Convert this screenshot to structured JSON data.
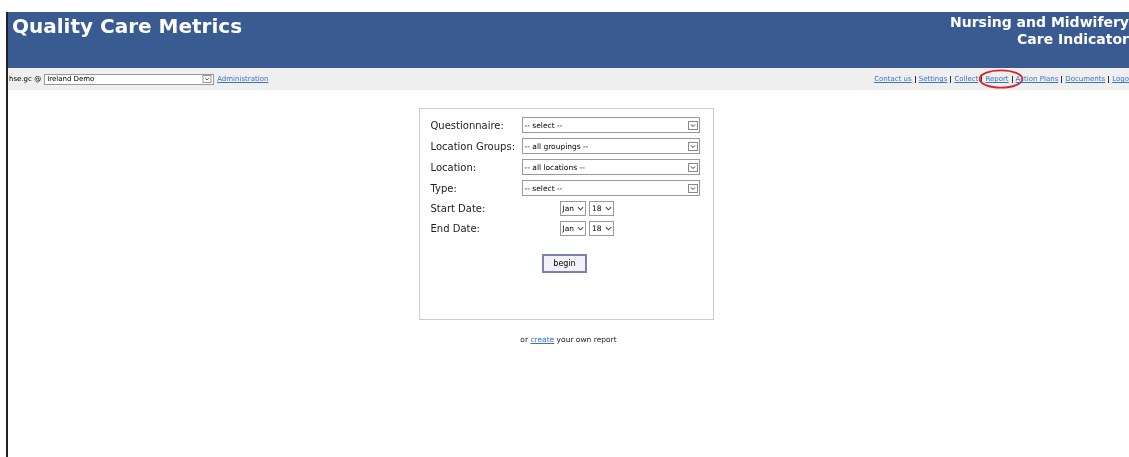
{
  "header": {
    "title": "Quality Care Metrics",
    "subtitle_lines": [
      "Nursing and Midwifery",
      "Care Indicator"
    ]
  },
  "toolbar": {
    "user_label": "hse.gc @",
    "site_select": "Ireland Demo",
    "admin_link": "Administration",
    "links": [
      {
        "label": "Contact us",
        "highlighted": false
      },
      {
        "label": "Settings",
        "highlighted": false
      },
      {
        "label": "Collect",
        "highlighted": false
      },
      {
        "label": "Report",
        "highlighted": true
      },
      {
        "label": "Action Plans",
        "highlighted": false
      },
      {
        "label": "Documents",
        "highlighted": false
      },
      {
        "label": "Logo",
        "highlighted": false
      }
    ]
  },
  "form": {
    "fields": [
      {
        "kind": "select",
        "label": "Questionnaire:",
        "value": "-- select --"
      },
      {
        "kind": "select",
        "label": "Location Groups:",
        "value": "-- all groupings --"
      },
      {
        "kind": "select",
        "label": "Location:",
        "value": "-- all locations --"
      },
      {
        "kind": "select",
        "label": "Type:",
        "value": "-- select --"
      },
      {
        "kind": "date",
        "label": "Start Date:",
        "month": "Jan",
        "year": "18"
      },
      {
        "kind": "date",
        "label": "End Date:",
        "month": "Jan",
        "year": "18"
      }
    ],
    "button": "begin"
  },
  "footer": {
    "before": "or",
    "link": "create",
    "after": "your own report"
  }
}
